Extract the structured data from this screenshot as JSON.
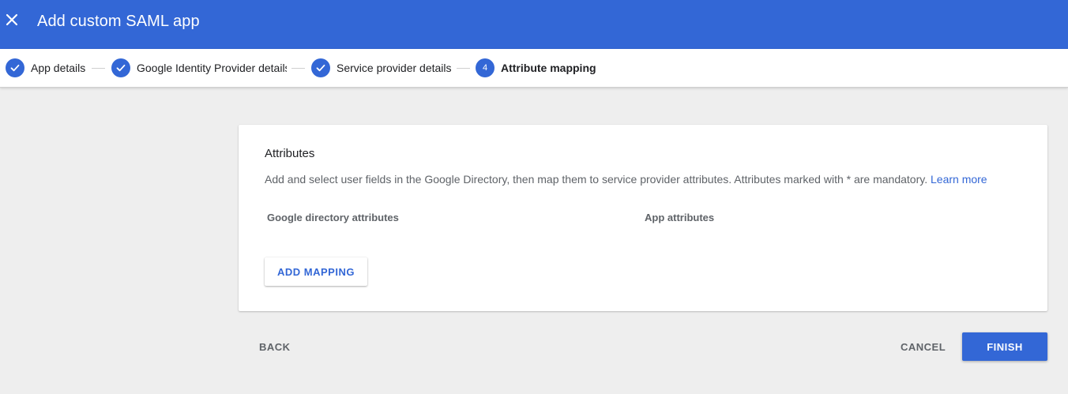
{
  "header": {
    "title": "Add custom SAML app",
    "close_icon": "close-icon",
    "background_color": "#3367d6"
  },
  "stepper": {
    "steps": [
      {
        "label": "App details",
        "state": "complete",
        "icon": "check-icon"
      },
      {
        "label": "Google Identity Provider details",
        "state": "complete",
        "icon": "check-icon"
      },
      {
        "label": "Service provider details",
        "state": "complete",
        "icon": "check-icon"
      },
      {
        "label": "Attribute mapping",
        "state": "active",
        "number": "4"
      }
    ]
  },
  "attributes_card": {
    "title": "Attributes",
    "description": "Add and select user fields in the Google Directory, then map them to service provider attributes. Attributes marked with * are mandatory.",
    "learn_more_label": "Learn more",
    "columns": [
      "Google directory attributes",
      "App attributes"
    ],
    "add_mapping_label": "ADD MAPPING"
  },
  "footer": {
    "back_label": "BACK",
    "cancel_label": "CANCEL",
    "finish_label": "FINISH"
  },
  "colors": {
    "accent": "#3367d6",
    "page_background": "#eeeeee"
  }
}
